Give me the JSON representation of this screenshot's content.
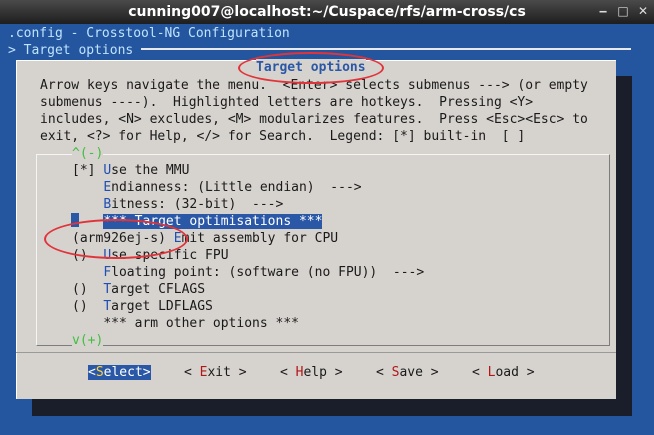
{
  "window": {
    "title": "cunning007@localhost:~/Cuspace/rfs/arm-cross/cs",
    "minimize_glyph": "‒",
    "maximize_glyph": "□",
    "close_glyph": "✕"
  },
  "header": {
    "line1": ".config - Crosstool-NG Configuration",
    "line2": "> Target options"
  },
  "dialog": {
    "title": "Target options",
    "help_lines": [
      "Arrow keys navigate the menu.  <Enter> selects submenus ---> (or empty",
      "submenus ----).  Highlighted letters are hotkeys.  Pressing <Y>",
      "includes, <N> excludes, <M> modularizes features.  Press <Esc><Esc> to",
      "exit, <?> for Help, </> for Search.  Legend: [*] built-in  [ ]"
    ]
  },
  "menu": {
    "scroll_up": "^(-)",
    "scroll_down": "v(+)",
    "items": [
      {
        "prefix": "[*] ",
        "hotkey": "U",
        "rest": "se the MMU"
      },
      {
        "prefix": "    ",
        "hotkey": "E",
        "rest": "ndianness: (Little endian)  --->"
      },
      {
        "prefix": "    ",
        "hotkey": "B",
        "rest": "itness: (32-bit)  --->"
      },
      {
        "prefix": "    ",
        "hotkey": "",
        "rest": "*** Target optimisations ***"
      },
      {
        "prefix": "(arm926ej-s) ",
        "hotkey": "E",
        "rest": "mit assembly for CPU"
      },
      {
        "prefix": "()  ",
        "hotkey": "U",
        "rest": "se specific FPU"
      },
      {
        "prefix": "    ",
        "hotkey": "F",
        "rest": "loating point: (software (no FPU))  --->"
      },
      {
        "prefix": "()  ",
        "hotkey": "T",
        "rest": "arget CFLAGS"
      },
      {
        "prefix": "()  ",
        "hotkey": "T",
        "rest": "arget LDFLAGS"
      },
      {
        "prefix": "    ",
        "hotkey": "",
        "rest": "*** arm other options ***"
      }
    ]
  },
  "buttons": [
    {
      "open": "<",
      "hotkey": "S",
      "rest": "elect",
      "close": ">"
    },
    {
      "open": "< ",
      "hotkey": "E",
      "rest": "xit",
      "close": " >"
    },
    {
      "open": "< ",
      "hotkey": "H",
      "rest": "elp",
      "close": " >"
    },
    {
      "open": "< ",
      "hotkey": "S",
      "rest": "ave",
      "close": " >"
    },
    {
      "open": "< ",
      "hotkey": "L",
      "rest": "oad",
      "close": " >"
    }
  ],
  "colors": {
    "terminal_bg": "#24569f",
    "dialog_bg": "#d6d2ce",
    "highlight": "#2b58a6",
    "hotkey_blue": "#1f4fb1",
    "hotkey_red": "#b31616",
    "scroll_arrow": "#3fbf3f",
    "annotation": "#e0343a"
  }
}
